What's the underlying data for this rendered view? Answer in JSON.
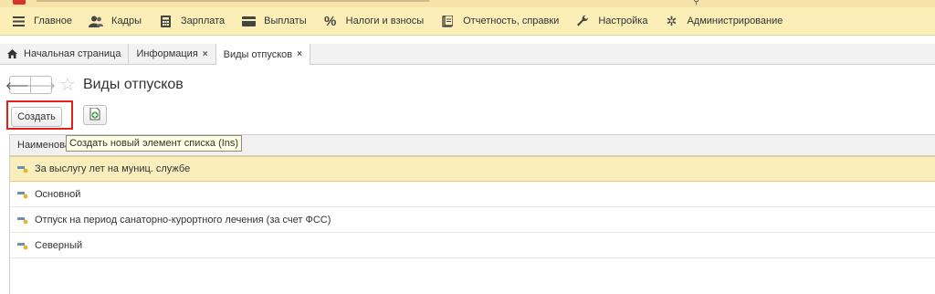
{
  "main_menu": [
    {
      "label": "Главное",
      "icon": "hamburger-icon"
    },
    {
      "label": "Кадры",
      "icon": "users-icon"
    },
    {
      "label": "Зарплата",
      "icon": "calculator-icon"
    },
    {
      "label": "Выплаты",
      "icon": "wallet-icon"
    },
    {
      "label": "Налоги и взносы",
      "icon": "percent-icon"
    },
    {
      "label": "Отчетность, справки",
      "icon": "report-icon"
    },
    {
      "label": "Настройка",
      "icon": "wrench-icon"
    },
    {
      "label": "Администрирование",
      "icon": "gear-icon"
    }
  ],
  "tabs": [
    {
      "label": "Начальная страница",
      "icon": "home-icon"
    },
    {
      "label": "Информация",
      "close": "×"
    },
    {
      "label": "Виды отпусков",
      "close": "×"
    }
  ],
  "form": {
    "title": "Виды отпусков"
  },
  "toolbar": {
    "create_label": "Создать"
  },
  "list": {
    "column_header": "Наименование",
    "rows": [
      "За выслугу лет на муниц. службе",
      "Основной",
      "Отпуск на период санаторно-курортного лечения (за счет ФСС)",
      "Северный"
    ]
  },
  "tooltip": "Создать новый элемент списка (Ins)",
  "colors": {
    "menu_bg": "#fbeeb6",
    "selected_row": "#fbeebd",
    "highlight_border": "#e0201b",
    "tooltip_bg": "#ffffe1"
  }
}
